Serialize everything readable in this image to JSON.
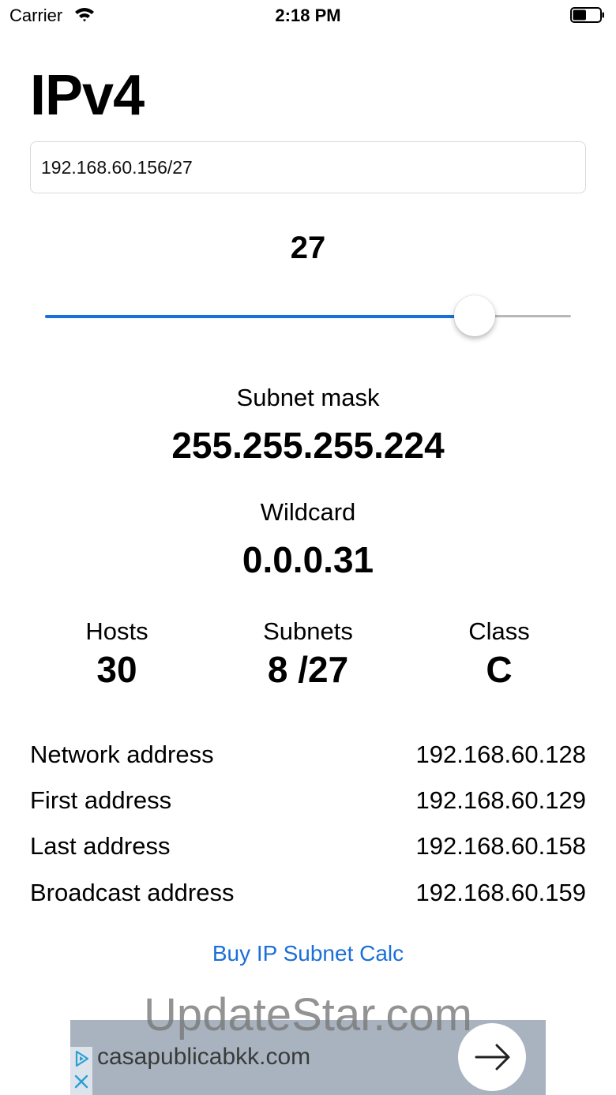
{
  "status_bar": {
    "carrier": "Carrier",
    "time": "2:18 PM",
    "battery_level": 0.5
  },
  "title": "IPv4",
  "ip_input": {
    "value": "192.168.60.156/27"
  },
  "prefix": {
    "value": "27",
    "slider_min": 0,
    "slider_max": 32,
    "slider_value": 27,
    "accent_color": "#1b6fd8"
  },
  "subnet_mask": {
    "label": "Subnet mask",
    "value": "255.255.255.224"
  },
  "wildcard": {
    "label": "Wildcard",
    "value": "0.0.0.31"
  },
  "stats": [
    {
      "label": "Hosts",
      "value": "30"
    },
    {
      "label": "Subnets",
      "value": "8 /27"
    },
    {
      "label": "Class",
      "value": "C"
    }
  ],
  "addresses": [
    {
      "name": "Network address",
      "value": "192.168.60.128"
    },
    {
      "name": "First address",
      "value": "192.168.60.129"
    },
    {
      "name": "Last address",
      "value": "192.168.60.158"
    },
    {
      "name": "Broadcast address",
      "value": "192.168.60.159"
    }
  ],
  "buy_link": "Buy IP Subnet Calc",
  "watermark": "UpdateStar.com",
  "ad": {
    "domain": "casapublicabkk.com",
    "icons": [
      "adchoices-play-icon",
      "ad-close-icon",
      "arrow-right-icon"
    ]
  }
}
